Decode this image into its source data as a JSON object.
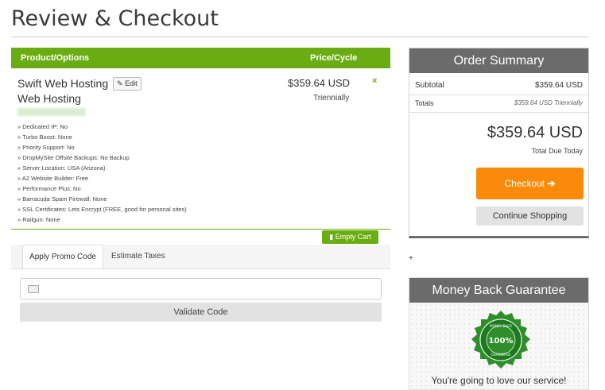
{
  "page": {
    "title": "Review & Checkout"
  },
  "cart": {
    "header": {
      "product_col": "Product/Options",
      "price_col": "Price/Cycle"
    },
    "item": {
      "name": "Swift Web Hosting",
      "edit_label": "Edit",
      "group": "Web Hosting",
      "options": [
        "» Dedicated IP: No",
        "» Turbo Boost: None",
        "» Priority Support: No",
        "» DropMySite Offsite Backups: No Backup",
        "» Server Location: USA (Arizona)",
        "» A2 Website Builder: Free",
        "» Performance Plus: No",
        "» Barracuda Spam Firewall: None",
        "» SSL Certificates: Lets Encrypt (FREE, good for personal sites)",
        "» Railgun: None"
      ],
      "price": "$359.64 USD",
      "cycle": "Triennially",
      "remove_icon": "×"
    },
    "empty_cart_label": "Empty Cart"
  },
  "promo": {
    "tabs": [
      "Apply Promo Code",
      "Estimate Taxes"
    ],
    "input_placeholder": "",
    "validate_label": "Validate Code"
  },
  "summary": {
    "title": "Order Summary",
    "subtotal_label": "Subtotal",
    "subtotal_value": "$359.64 USD",
    "totals_label": "Totals",
    "totals_value": "$359.64 USD Triennially",
    "total_amount": "$359.64 USD",
    "total_due_label": "Total Due Today",
    "checkout_label": "Checkout",
    "checkout_icon": "arrow-right-icon",
    "continue_label": "Continue Shopping"
  },
  "plus_text": "+",
  "money_back": {
    "title": "Money Back Guarantee",
    "seal_top": "MONEY BACK",
    "seal_center": "100%",
    "seal_bottom": "GUARANTEE",
    "text": "You're going to love our service!"
  },
  "colors": {
    "green": "#6aad12",
    "orange": "#f98a0a",
    "dark_gray": "#6b6b6b"
  }
}
